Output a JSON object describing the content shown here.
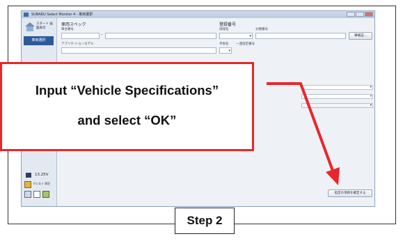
{
  "window": {
    "title": "SUBARU Select Monitor 4 - 車両選択"
  },
  "sidebar": {
    "home_label": "スタート 画面表示",
    "active_item": "車両選択",
    "battery_voltage": "13.25V",
    "bottom_label": "アシスト 再生"
  },
  "form": {
    "vehicle_spec_heading": "車両スペック",
    "chassis_label": "車台番号",
    "application_model_label": "アプリケ-ションモデル",
    "registration_heading": "登録番号",
    "region_label": "地域名",
    "classification_label": "分類番号",
    "kana_label": "平仮名",
    "serial_label": "一連指定番号",
    "search_button": "車検証…",
    "ok_button": "指定の項目を確定する"
  },
  "callout": {
    "line1": "Input “Vehicle Specifications”",
    "line2": "and select “OK”"
  },
  "step": {
    "label": "Step 2"
  },
  "colors": {
    "callout_border": "#e8262c",
    "arrow": "#e8262c",
    "sidebar_active": "#2d5b9a"
  }
}
